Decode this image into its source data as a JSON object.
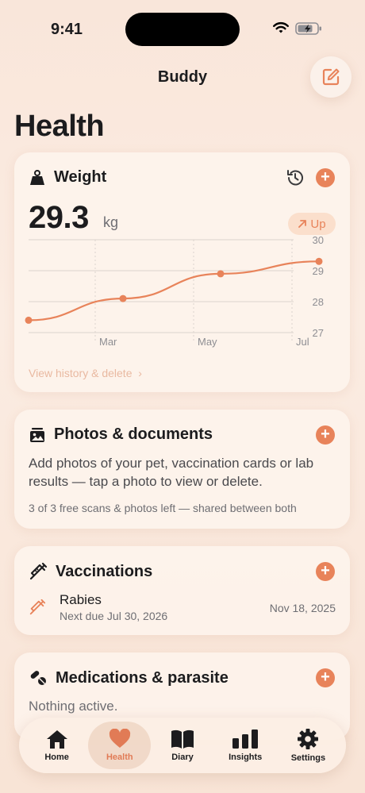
{
  "status": {
    "time": "9:41"
  },
  "nav": {
    "title": "Buddy"
  },
  "page": {
    "title": "Health"
  },
  "weight": {
    "title": "Weight",
    "value": "29.3",
    "unit": "kg",
    "trend": "Up",
    "view_history": "View history & delete",
    "chart_data": {
      "type": "line",
      "x_tick_labels": [
        "Mar",
        "May",
        "Jul"
      ],
      "y_ticks": [
        30,
        29,
        28,
        27
      ],
      "ylim": [
        27,
        30
      ],
      "series": [
        {
          "values": [
            27.4,
            28.1,
            28.9,
            29.3
          ]
        }
      ],
      "grid": true
    }
  },
  "photos": {
    "title": "Photos & documents",
    "description": "Add photos of your pet, vaccination cards or lab results — tap a photo to view or delete.",
    "quota": "3 of 3 free scans & photos left — shared between both"
  },
  "vaccinations": {
    "title": "Vaccinations",
    "items": [
      {
        "name": "Rabies",
        "next_due": "Next due Jul 30, 2026",
        "date": "Nov 18, 2025"
      }
    ]
  },
  "medications": {
    "title": "Medications & parasite",
    "empty": "Nothing active."
  },
  "tabs": [
    {
      "label": "Home",
      "icon": "home-icon"
    },
    {
      "label": "Health",
      "icon": "heart-icon",
      "active": true
    },
    {
      "label": "Diary",
      "icon": "book-icon"
    },
    {
      "label": "Insights",
      "icon": "bar-chart-icon"
    },
    {
      "label": "Settings",
      "icon": "gear-icon"
    }
  ],
  "colors": {
    "accent": "#e8835a",
    "background": "#f9e6da"
  }
}
